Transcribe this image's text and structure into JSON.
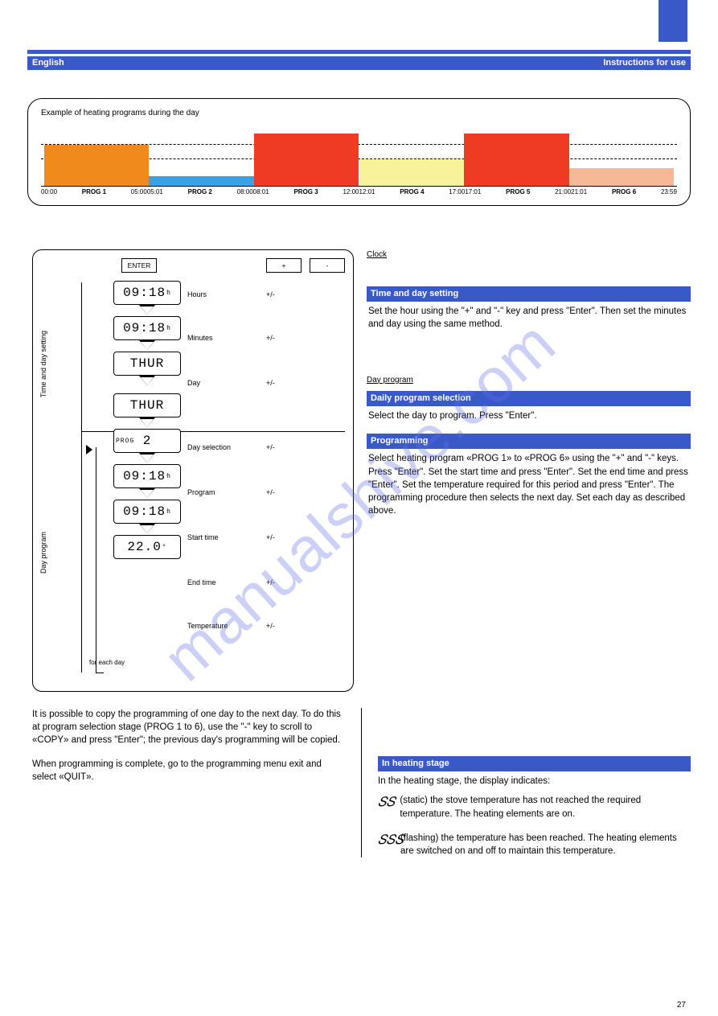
{
  "page": {
    "number": "27",
    "footer": "27",
    "watermark": "manualshive.com"
  },
  "header": {
    "section_left": "English",
    "section_right": "Instructions for use"
  },
  "chart_data": {
    "type": "bar",
    "title": "Example of heating programs during the day",
    "gridlines": [
      65,
      42
    ],
    "categories": [
      "PROG 1",
      "PROG 2",
      "PROG 3",
      "PROG 4",
      "PROG 5",
      "PROG 6"
    ],
    "bars": [
      {
        "height": 65,
        "color": "#f08a1d"
      },
      {
        "height": 15,
        "color": "#39a2e6"
      },
      {
        "height": 82,
        "color": "#ef3b24"
      },
      {
        "height": 42,
        "color": "#f8f29a"
      },
      {
        "height": 82,
        "color": "#ef3b24"
      },
      {
        "height": 28,
        "color": "#f6b998"
      }
    ],
    "xticks": [
      "00:00",
      "05:00",
      "05:01",
      "08:00",
      "08:01",
      "12:00",
      "12:01",
      "17:00",
      "17:01",
      "21:00",
      "21:01",
      "23:59"
    ]
  },
  "flow": {
    "header_boxes": [
      "ENTER",
      "+",
      "-"
    ],
    "vertical_label_top": "Time and day setting",
    "vertical_label_bottom": "Day program",
    "steps": [
      {
        "display": "09:18",
        "unit": "h",
        "side": "Hours",
        "side2": "+/-"
      },
      {
        "display": "09:18",
        "unit": "h",
        "side": "Minutes",
        "side2": "+/-"
      },
      {
        "display": "THUR",
        "unit": "",
        "side": "Day",
        "side2": "+/-"
      },
      {
        "display": "THUR",
        "unit": "",
        "side": "Day selection",
        "side2": "+/-"
      },
      {
        "display": "2",
        "prefix": "PROG",
        "side": "Program",
        "side2": "+/-"
      },
      {
        "display": "09:18",
        "unit": "h",
        "side": "Start time",
        "side2": "+/-"
      },
      {
        "display": "09:18",
        "unit": "h",
        "side": "End time",
        "side2": "+/-"
      },
      {
        "display": "22.0",
        "unit": "°",
        "side": "Temperature",
        "side2": "+/-"
      }
    ],
    "loop_label": "for each day"
  },
  "right_sections": [
    {
      "label": "Clock",
      "heading": "Time and day setting",
      "text": "Set the hour using the \"+\" and \"-\" key and press \"Enter\". Then set the minutes and day using the same method."
    },
    {
      "label": "Day program",
      "heading": "Daily program selection",
      "text": "Select the day to program. Press \"Enter\"."
    },
    {
      "heading": "Programming",
      "text": "Select heating program «PROG 1» to «PROG 6» using the \"+\" and \"-\" keys. Press \"Enter\". Set the start time and press \"Enter\". Set the end time and press \"Enter\". Set the temperature required for this period and press \"Enter\". The programming procedure then selects the next day. Set each day as described above."
    }
  ],
  "bottom": {
    "left": {
      "p1": "It is possible to copy the programming of one day to the next day. To do this at program selection stage (PROG 1 to 6), use the \"-\" key to scroll to «COPY» and press \"Enter\"; the previous day's programming will be copied.",
      "p2": "When programming is complete, go to the programming menu exit and select «QUIT»."
    },
    "right": {
      "heading": "In heating stage",
      "lead": "In the heating stage, the display indicates:",
      "icon1_label": "(static)",
      "icon1_text": "the stove temperature has not reached the required temperature. The heating elements are on.",
      "icon2_label": "(flashing)",
      "icon2_text": "the temperature has been reached. The heating elements are switched on and off to maintain this temperature."
    }
  }
}
